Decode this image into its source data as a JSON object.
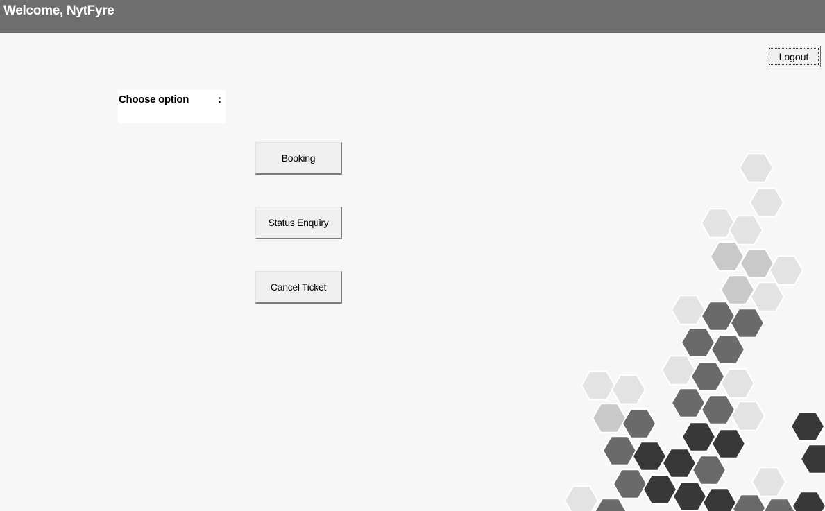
{
  "header": {
    "title": "Welcome, NytFyre"
  },
  "logout": {
    "label": "Logout"
  },
  "chooser": {
    "label": "Choose option",
    "colon": ":"
  },
  "options": [
    {
      "label": "Booking"
    },
    {
      "label": "Status Enquiry"
    },
    {
      "label": "Cancel Ticket"
    }
  ],
  "colors": {
    "header_bg": "#6e6e6e",
    "page_bg": "#f7f7f7",
    "button_bg": "#f0f0f0",
    "hex_light": "#e3e3e3",
    "hex_mid": "#c9c9c9",
    "hex_dark": "#6a6a6a",
    "hex_black": "#383838"
  }
}
